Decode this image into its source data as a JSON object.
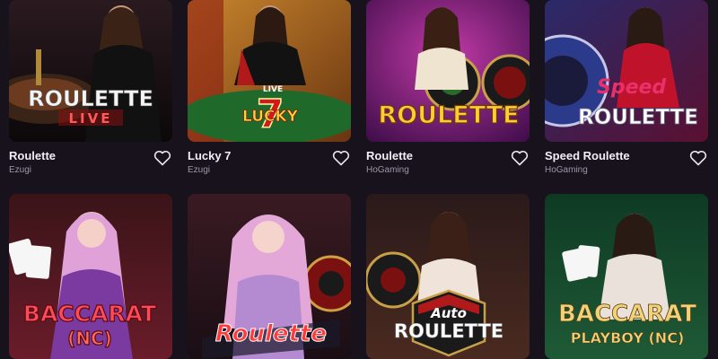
{
  "games": [
    {
      "title": "Roulette",
      "provider": "Ezugi",
      "thumb_lines": [
        "ROULETTE",
        "LIVE"
      ],
      "favorite_icon": "heart-outline-icon"
    },
    {
      "title": "Lucky 7",
      "provider": "Ezugi",
      "thumb_lines": [
        "LIVE",
        "7",
        "LUCKY"
      ],
      "favorite_icon": "heart-outline-icon"
    },
    {
      "title": "Roulette",
      "provider": "HoGaming",
      "thumb_lines": [
        "ROULETTE"
      ],
      "favorite_icon": "heart-outline-icon"
    },
    {
      "title": "Speed Roulette",
      "provider": "HoGaming",
      "thumb_lines": [
        "Speed",
        "ROULETTE"
      ],
      "favorite_icon": "heart-outline-icon"
    },
    {
      "thumb_lines": [
        "BACCARAT",
        "(NC)"
      ]
    },
    {
      "thumb_lines": [
        "Roulette"
      ]
    },
    {
      "thumb_lines": [
        "Auto",
        "ROULETTE"
      ]
    },
    {
      "thumb_lines": [
        "BACCARAT",
        "PLAYBOY (NC)"
      ]
    }
  ],
  "colors": {
    "page_background": "#17121c",
    "title_text": "#f2eef6",
    "provider_text": "#9d97a6"
  }
}
